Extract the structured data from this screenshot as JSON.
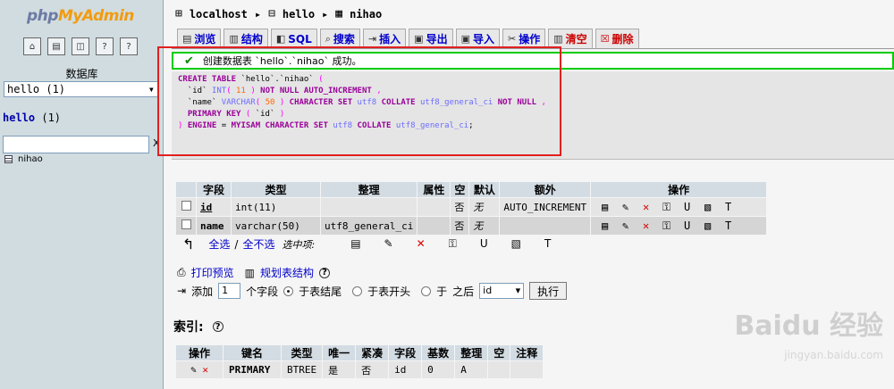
{
  "sidebar": {
    "logo_left": "php",
    "logo_right": "MyAdmin",
    "icons": [
      "home-icon",
      "sql-icon",
      "sql-window-icon",
      "docs-icon",
      "help-icon"
    ],
    "db_label": "数据库",
    "db_select": "hello (1)",
    "db_heading": "hello",
    "db_count": "(1)",
    "filter_clear": "X",
    "tables": [
      {
        "label": "nihao"
      }
    ]
  },
  "breadcrumb": {
    "server": "localhost",
    "db": "hello",
    "table": "nihao"
  },
  "tabs": [
    {
      "label": "浏览",
      "icon": "browse-icon"
    },
    {
      "label": "结构",
      "icon": "structure-icon"
    },
    {
      "label": "SQL",
      "icon": "sql-icon"
    },
    {
      "label": "搜索",
      "icon": "search-icon"
    },
    {
      "label": "插入",
      "icon": "insert-icon"
    },
    {
      "label": "导出",
      "icon": "export-icon"
    },
    {
      "label": "导入",
      "icon": "import-icon"
    },
    {
      "label": "操作",
      "icon": "operations-icon"
    },
    {
      "label": "清空",
      "icon": "empty-icon"
    },
    {
      "label": "删除",
      "icon": "drop-icon"
    }
  ],
  "message": {
    "text": "创建数据表 `hello`.`nihao` 成功。"
  },
  "sql_lines": [
    "CREATE TABLE `hello`.`nihao` (",
    "  `id` INT( 11 ) NOT NULL AUTO_INCREMENT ,",
    "  `name` VARCHAR( 50 ) CHARACTER SET utf8 COLLATE utf8_general_ci NOT NULL ,",
    "  PRIMARY KEY ( `id` )",
    ") ENGINE = MYISAM CHARACTER SET utf8 COLLATE utf8_general_ci;"
  ],
  "structure": {
    "headers": [
      "",
      "字段",
      "类型",
      "整理",
      "属性",
      "空",
      "默认",
      "额外",
      "操作"
    ],
    "rows": [
      {
        "field": "id",
        "type": "int(11)",
        "collation": "",
        "attr": "",
        "null": "否",
        "default": "无",
        "extra": "AUTO_INCREMENT"
      },
      {
        "field": "name",
        "type": "varchar(50)",
        "collation": "utf8_general_ci",
        "attr": "",
        "null": "否",
        "default": "无",
        "extra": ""
      }
    ]
  },
  "selection": {
    "check_all": "全选",
    "sep": "/",
    "uncheck_all": "全不选",
    "with_selected": "选中项:"
  },
  "print": {
    "print_view": "打印预览",
    "propose": "规划表结构"
  },
  "add_field": {
    "add": "添加",
    "count": "1",
    "fields": "个字段",
    "at_end": "于表结尾",
    "at_begin": "于表开头",
    "after_pre": "于",
    "after_post": "之后",
    "after_col": "id",
    "go": "执行"
  },
  "indexes": {
    "title": "索引:",
    "headers": [
      "操作",
      "键名",
      "类型",
      "唯一",
      "紧凑",
      "字段",
      "基数",
      "整理",
      "空",
      "注释"
    ],
    "rows": [
      {
        "key": "PRIMARY",
        "type": "BTREE",
        "unique": "是",
        "packed": "否",
        "field": "id",
        "cardinality": "0",
        "collation": "A",
        "null": "",
        "comment": ""
      }
    ]
  },
  "watermark": {
    "line1": "Baidu 经验",
    "line2": "jingyan.baidu.com"
  }
}
